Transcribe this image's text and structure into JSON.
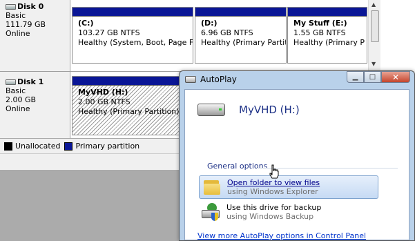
{
  "disk_management": {
    "disks": [
      {
        "name": "Disk 0",
        "type": "Basic",
        "size": "111.79 GB",
        "status": "Online",
        "partitions": [
          {
            "title": "(C:)",
            "size": "103.27 GB NTFS",
            "status": "Healthy (System, Boot, Page Fi"
          },
          {
            "title": "(D:)",
            "size": "6.96 GB NTFS",
            "status": "Healthy (Primary Partit"
          },
          {
            "title": "My Stuff  (E:)",
            "size": "1.55 GB NTFS",
            "status": "Healthy (Primary P"
          }
        ]
      },
      {
        "name": "Disk 1",
        "type": "Basic",
        "size": "2.00 GB",
        "status": "Online",
        "partitions": [
          {
            "title": "MyVHD  (H:)",
            "size": "2.00 GB NTFS",
            "status": "Healthy (Primary Partition)"
          }
        ]
      }
    ],
    "legend": [
      {
        "label": "Unallocated",
        "color": "#000000"
      },
      {
        "label": "Primary partition",
        "color": "#0a1696"
      }
    ]
  },
  "autoplay": {
    "title": "AutoPlay",
    "volume": "MyVHD (H:)",
    "group_label": "General options",
    "options": [
      {
        "title": "Open folder to view files",
        "subtitle": "using Windows Explorer",
        "icon": "folder-icon"
      },
      {
        "title": "Use this drive for backup",
        "subtitle": "using Windows Backup",
        "icon": "backup-icon"
      }
    ],
    "more_link": "View more AutoPlay options in Control Panel"
  },
  "colors": {
    "partition_bar": "#0a1696",
    "link": "#0033cc",
    "header_text": "#1e3287"
  }
}
